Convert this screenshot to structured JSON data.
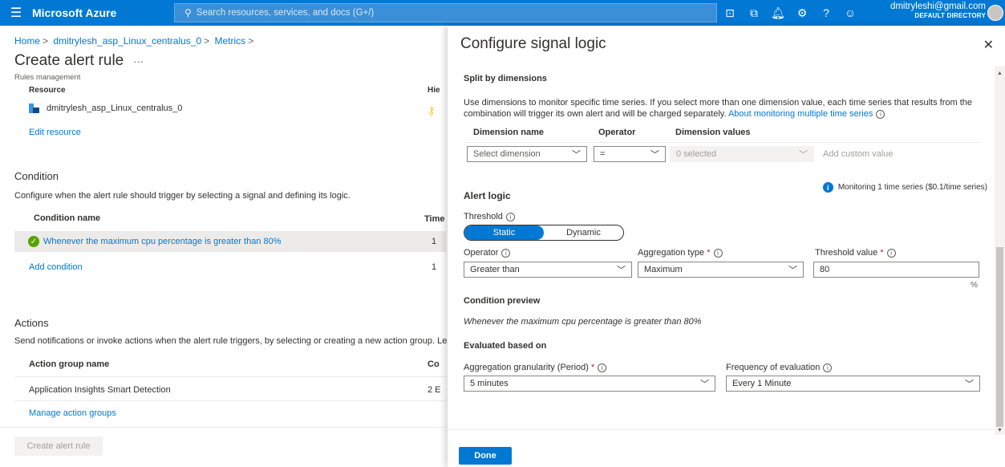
{
  "topbar": {
    "brand": "Microsoft Azure",
    "search_placeholder": "Search resources, services, and docs (G+/)",
    "account_email": "dmitryleshi@gmail.com",
    "account_directory": "DEFAULT DIRECTORY"
  },
  "breadcrumb": [
    "Home",
    "dmitrylesh_asp_Linux_centralus_0",
    "Metrics"
  ],
  "page": {
    "title": "Create alert rule",
    "subtitle": "Rules management",
    "resource_header": "Resource",
    "resource_header2": "Hie",
    "resource_name": "dmitrylesh_asp_Linux_centralus_0",
    "edit_resource": "Edit resource"
  },
  "condition": {
    "title": "Condition",
    "description": "Configure when the alert rule should trigger by selecting a signal and defining its logic.",
    "col_name": "Condition name",
    "col_time": "Time",
    "row_name": "Whenever the maximum cpu percentage is greater than 80%",
    "row_value": "1",
    "add_condition": "Add condition",
    "add_value": "1"
  },
  "actions": {
    "title": "Actions",
    "description": "Send notifications or invoke actions when the alert rule triggers, by selecting or creating a new action group. Lea",
    "col_name": "Action group name",
    "col_2": "Co",
    "row_name": "Application Insights Smart Detection",
    "row_value": "2 E",
    "manage": "Manage action groups",
    "create_button": "Create alert rule"
  },
  "panel": {
    "title": "Configure signal logic",
    "split_title": "Split by dimensions",
    "split_desc_1": "Use dimensions to monitor specific time series. If you select more than one dimension value, each time series that results from the",
    "split_desc_2": "combination will trigger its own alert and will be charged separately.",
    "split_link": "About monitoring multiple time series",
    "dim_name_head": "Dimension name",
    "dim_op_head": "Operator",
    "dim_val_head": "Dimension values",
    "dim_select": "Select dimension",
    "dim_op": "=",
    "dim_values": "0 selected",
    "dim_custom": "Add custom value",
    "monitoring": "Monitoring 1 time series ($0.1/time series)",
    "alert_logic": "Alert logic",
    "threshold_label": "Threshold",
    "toggle_static": "Static",
    "toggle_dynamic": "Dynamic",
    "operator_label": "Operator",
    "operator_value": "Greater than",
    "agg_type_label": "Aggregation type",
    "agg_type_value": "Maximum",
    "threshold_value_label": "Threshold value",
    "threshold_value": "80",
    "unit": "%",
    "preview_title": "Condition preview",
    "preview_text": "Whenever the maximum cpu percentage is greater than 80%",
    "evaluated_title": "Evaluated based on",
    "granularity_label": "Aggregation granularity (Period)",
    "granularity_value": "5 minutes",
    "frequency_label": "Frequency of evaluation",
    "frequency_value": "Every 1 Minute",
    "done": "Done",
    "req_mark": "*",
    "info_mark": "i"
  },
  "colors": {
    "azure_blue": "#0078d4",
    "success_green": "#57a300",
    "required_red": "#a4262c"
  }
}
